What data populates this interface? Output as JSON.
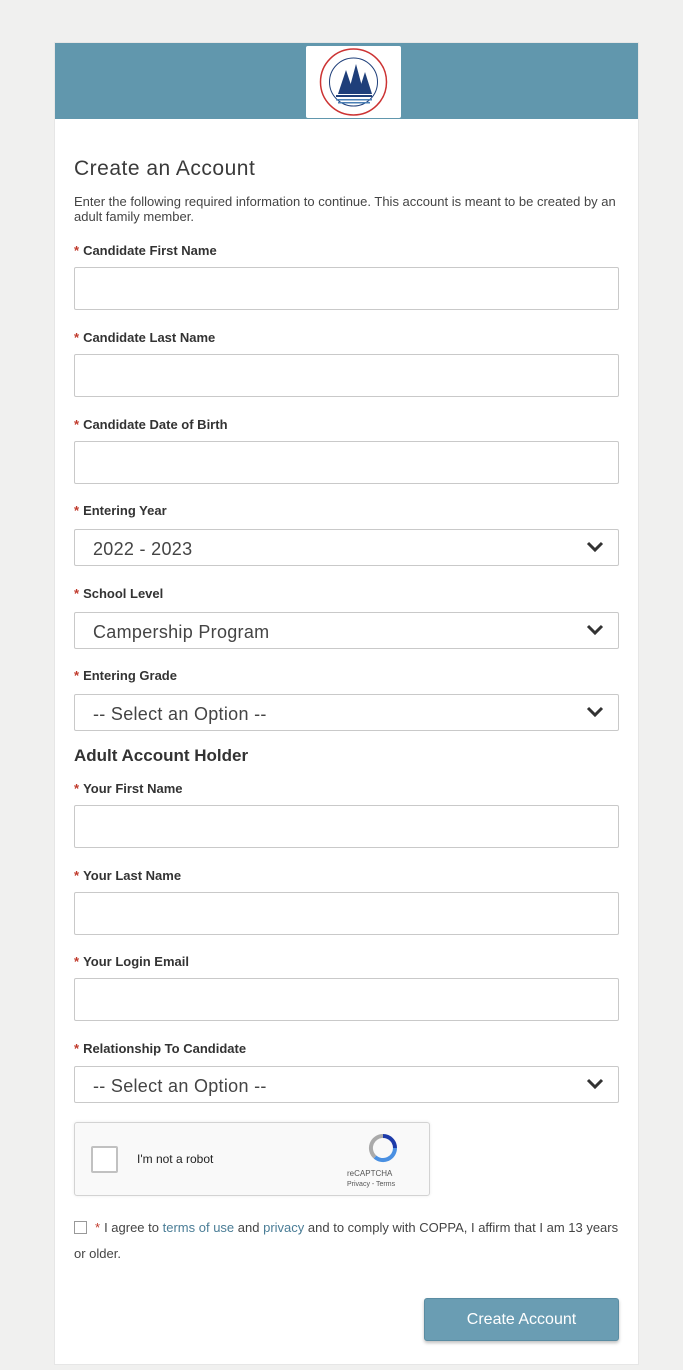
{
  "form": {
    "title": "Create an Account",
    "description": "Enter the following required information to continue. This account is meant to be created by an adult family member.",
    "required_marker": "*",
    "fields": {
      "candidate_first_name": {
        "label": "Candidate First Name",
        "value": ""
      },
      "candidate_last_name": {
        "label": "Candidate Last Name",
        "value": ""
      },
      "candidate_dob": {
        "label": "Candidate Date of Birth",
        "value": ""
      },
      "entering_year": {
        "label": "Entering Year",
        "selected": "2022 - 2023"
      },
      "school_level": {
        "label": "School Level",
        "selected": "Campership Program"
      },
      "entering_grade": {
        "label": "Entering Grade",
        "selected": "-- Select an Option --"
      },
      "your_first_name": {
        "label": "Your First Name",
        "value": ""
      },
      "your_last_name": {
        "label": "Your Last Name",
        "value": ""
      },
      "login_email": {
        "label": "Your Login Email",
        "value": ""
      },
      "relationship": {
        "label": "Relationship To Candidate",
        "selected": "-- Select an Option --"
      }
    },
    "section_adult": "Adult Account Holder",
    "recaptcha": {
      "label": "I'm not a robot",
      "brand": "reCAPTCHA",
      "links": "Privacy - Terms"
    },
    "agreement": {
      "prefix": "I agree to",
      "terms_link": "terms of use",
      "and": "and",
      "privacy_link": "privacy",
      "suffix": "and to comply with COPPA, I affirm that I am 13 years or older."
    },
    "submit_label": "Create Account"
  },
  "colors": {
    "header": "#6197ad",
    "button": "#6a9db3",
    "required": "#c0392b",
    "link": "#4a7d96"
  },
  "icons": {
    "logo": "camp-logo-icon",
    "select_arrow": "chevron-down-icon",
    "recaptcha": "recaptcha-icon"
  }
}
